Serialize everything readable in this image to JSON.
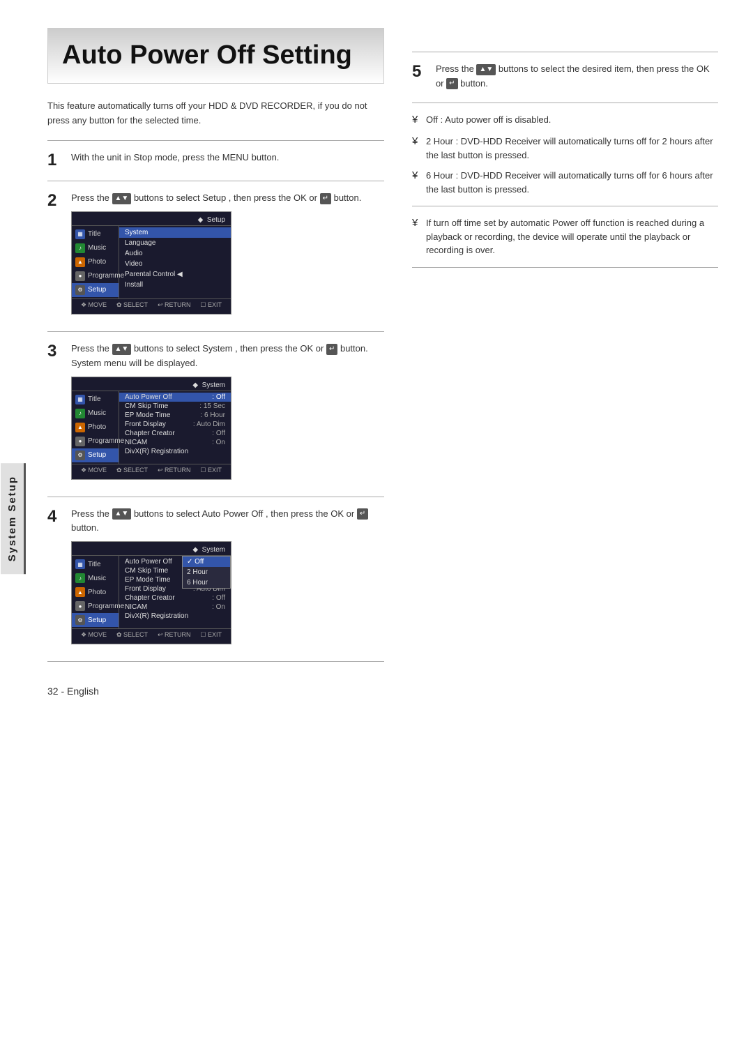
{
  "title": "Auto Power Off Setting",
  "intro": "This feature automatically turns off your HDD & DVD RECORDER, if you do not press any button for the selected time.",
  "sidebar_label": "System Setup",
  "steps": [
    {
      "number": "1",
      "text": "With the unit in Stop mode, press the MENU button."
    },
    {
      "number": "2",
      "text": "Press the      buttons to select Setup , then press the OK or      button."
    },
    {
      "number": "3",
      "text": "Press the      buttons to select System , then press the OK or      button.\nSystem menu will be displayed."
    },
    {
      "number": "4",
      "text": "Press the      buttons to select Auto Power Off , then press the OK or      button."
    },
    {
      "number": "5",
      "text": "Press the      buttons to select the desired item, then press the OK or      button."
    }
  ],
  "menu1": {
    "header": "◆  Setup",
    "sidebar_items": [
      {
        "label": "Title",
        "icon": "▦",
        "icon_class": "blue"
      },
      {
        "label": "Music",
        "icon": "♪",
        "icon_class": "green"
      },
      {
        "label": "Photo",
        "icon": "▲",
        "icon_class": "orange"
      },
      {
        "label": "Programme",
        "icon": "●",
        "icon_class": "gray"
      },
      {
        "label": "Setup",
        "icon": "⚙",
        "icon_class": "active",
        "active": true
      }
    ],
    "items": [
      {
        "label": "System",
        "highlighted": true
      },
      {
        "label": "Language"
      },
      {
        "label": "Audio"
      },
      {
        "label": "Video"
      },
      {
        "label": "Parental Control  ◀"
      },
      {
        "label": "Install"
      }
    ],
    "footer": "❖ MOVE   ✿ SELECT   ↩ RETURN   ☐ EXIT"
  },
  "menu2": {
    "header": "◆  System",
    "sidebar_items": [
      {
        "label": "Title",
        "icon": "▦",
        "icon_class": "blue"
      },
      {
        "label": "Music",
        "icon": "♪",
        "icon_class": "green"
      },
      {
        "label": "Photo",
        "icon": "▲",
        "icon_class": "orange"
      },
      {
        "label": "Programme",
        "icon": "●",
        "icon_class": "gray"
      },
      {
        "label": "Setup",
        "icon": "⚙",
        "active": true
      }
    ],
    "items": [
      {
        "label": "Auto Power Off",
        "value": ": Off",
        "highlighted": true
      },
      {
        "label": "CM Skip Time",
        "value": ": 15 Sec"
      },
      {
        "label": "EP Mode Time",
        "value": ": 6 Hour"
      },
      {
        "label": "Front Display",
        "value": ": Auto Dim"
      },
      {
        "label": "Chapter Creator",
        "value": ": Off"
      },
      {
        "label": "NICAM",
        "value": ": On"
      },
      {
        "label": "DivX(R) Registration",
        "value": ""
      }
    ],
    "footer": "❖ MOVE   ✿ SELECT   ↩ RETURN   ☐ EXIT"
  },
  "menu3": {
    "header": "◆  System",
    "sidebar_items": [
      {
        "label": "Title",
        "icon": "▦",
        "icon_class": "blue"
      },
      {
        "label": "Music",
        "icon": "♪",
        "icon_class": "green"
      },
      {
        "label": "Photo",
        "icon": "▲",
        "icon_class": "orange"
      },
      {
        "label": "Programme",
        "icon": "●",
        "icon_class": "gray"
      },
      {
        "label": "Setup",
        "icon": "⚙",
        "active": true
      }
    ],
    "items": [
      {
        "label": "Auto Power Off",
        "value": "",
        "highlighted": false
      },
      {
        "label": "CM Skip Time",
        "value": "",
        "highlighted": false
      },
      {
        "label": "EP Mode Time",
        "value": "",
        "highlighted": false
      },
      {
        "label": "Front Display",
        "value": ": Auto Dim"
      },
      {
        "label": "Chapter Creator",
        "value": ": Off"
      },
      {
        "label": "NICAM",
        "value": ": On"
      },
      {
        "label": "DivX(R) Registration",
        "value": ""
      }
    ],
    "popup_items": [
      {
        "label": "Off",
        "highlighted": true
      },
      {
        "label": "2 Hour",
        "highlighted": false
      },
      {
        "label": "6 Hour",
        "highlighted": false
      }
    ],
    "footer": "❖ MOVE   ✿ SELECT   ↩ RETURN   ☐ EXIT"
  },
  "bullets": [
    {
      "mark": "¥",
      "text": "Off : Auto power off is disabled."
    },
    {
      "mark": "¥",
      "text": "2 Hour : DVD-HDD Receiver will automatically turns off for 2 hours after the last button is pressed."
    },
    {
      "mark": "¥",
      "text": "6 Hour : DVD-HDD Receiver will automatically turns off for 6 hours after the last button is pressed."
    },
    {
      "mark": "¥",
      "text": "If turn off time set by automatic Power off function is reached during a playback or recording, the device will operate until the playback or recording is over."
    }
  ],
  "page_number": "32 - English"
}
